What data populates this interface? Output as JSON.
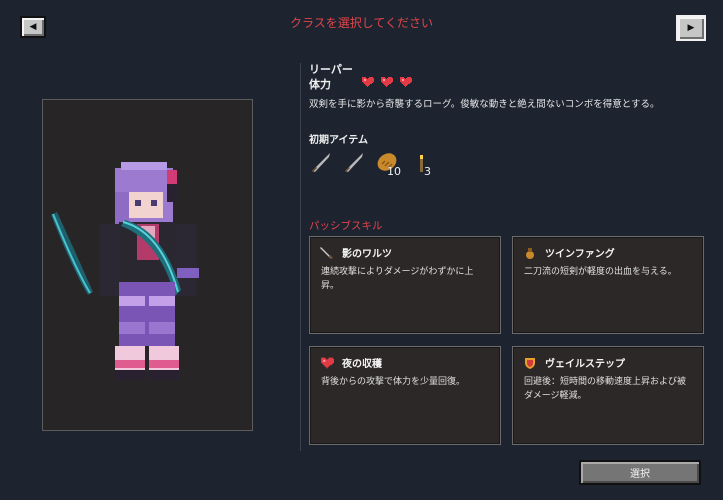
{
  "header": {
    "title": "クラスを選択してください",
    "prev_icon": "◀",
    "next_icon": "▶"
  },
  "class_info": {
    "name": "リーパー",
    "hp_label": "体力",
    "hearts": 3,
    "description": "双剣を手に影から奇襲するローグ。俊敏な動きと絶え間ないコンボを得意とする。"
  },
  "initial_items": {
    "label": "初期アイテム",
    "items": [
      {
        "icon": "dagger-icon",
        "count": ""
      },
      {
        "icon": "dagger-icon",
        "count": ""
      },
      {
        "icon": "bread-icon",
        "count": "10"
      },
      {
        "icon": "torch-icon",
        "count": "3"
      }
    ]
  },
  "passive": {
    "label": "パッシブスキル",
    "skills": [
      {
        "icon": "sword-icon",
        "name": "影のワルツ",
        "desc": "連続攻撃によりダメージがわずかに上昇。"
      },
      {
        "icon": "pouch-icon",
        "name": "ツインファング",
        "desc": "二刀流の短剣が軽度の出血を与える。"
      },
      {
        "icon": "heart-icon",
        "name": "夜の収穫",
        "desc": "背後からの攻撃で体力を少量回復。"
      },
      {
        "icon": "shield-icon",
        "name": "ヴェイルステップ",
        "desc": "回避後：短時間の移動速度上昇および被ダメージ軽減。"
      }
    ]
  },
  "footer": {
    "select_label": "選択"
  },
  "colors": {
    "background": "#1d2430",
    "accent_red": "#e0444a",
    "panel": "#2c2827"
  }
}
